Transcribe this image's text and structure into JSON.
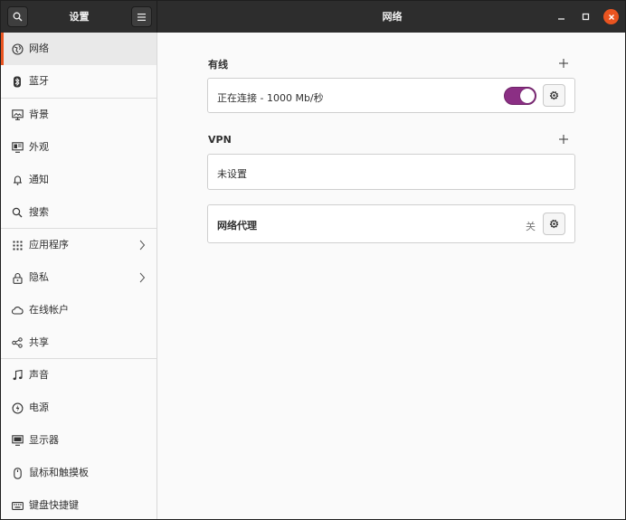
{
  "header": {
    "sidebar_title": "设置",
    "title": "网络",
    "search_icon": "search-icon",
    "menu_icon": "hamburger-menu-icon"
  },
  "sidebar": {
    "items": [
      {
        "label": "网络",
        "icon": "network-globe-icon"
      },
      {
        "label": "蓝牙",
        "icon": "bluetooth-icon"
      },
      {
        "label": "背景",
        "icon": "background-monitor-icon"
      },
      {
        "label": "外观",
        "icon": "appearance-icon"
      },
      {
        "label": "通知",
        "icon": "bell-icon"
      },
      {
        "label": "搜索",
        "icon": "search-icon"
      },
      {
        "label": "应用程序",
        "icon": "apps-grid-icon"
      },
      {
        "label": "隐私",
        "icon": "lock-icon"
      },
      {
        "label": "在线帐户",
        "icon": "cloud-icon"
      },
      {
        "label": "共享",
        "icon": "share-icon"
      },
      {
        "label": "声音",
        "icon": "music-note-icon"
      },
      {
        "label": "电源",
        "icon": "power-icon"
      },
      {
        "label": "显示器",
        "icon": "display-icon"
      },
      {
        "label": "鼠标和触摸板",
        "icon": "mouse-icon"
      },
      {
        "label": "键盘快捷键",
        "icon": "keyboard-icon"
      }
    ]
  },
  "wired": {
    "title": "有线",
    "status": "正在连接 - 1000 Mb/秒",
    "enabled": true
  },
  "vpn": {
    "title": "VPN",
    "status": "未设置"
  },
  "proxy": {
    "title": "网络代理",
    "status": "关"
  },
  "colors": {
    "accent": "#e95420",
    "switch_on": "#8b2f84",
    "header_bg": "#2d2d2d"
  }
}
